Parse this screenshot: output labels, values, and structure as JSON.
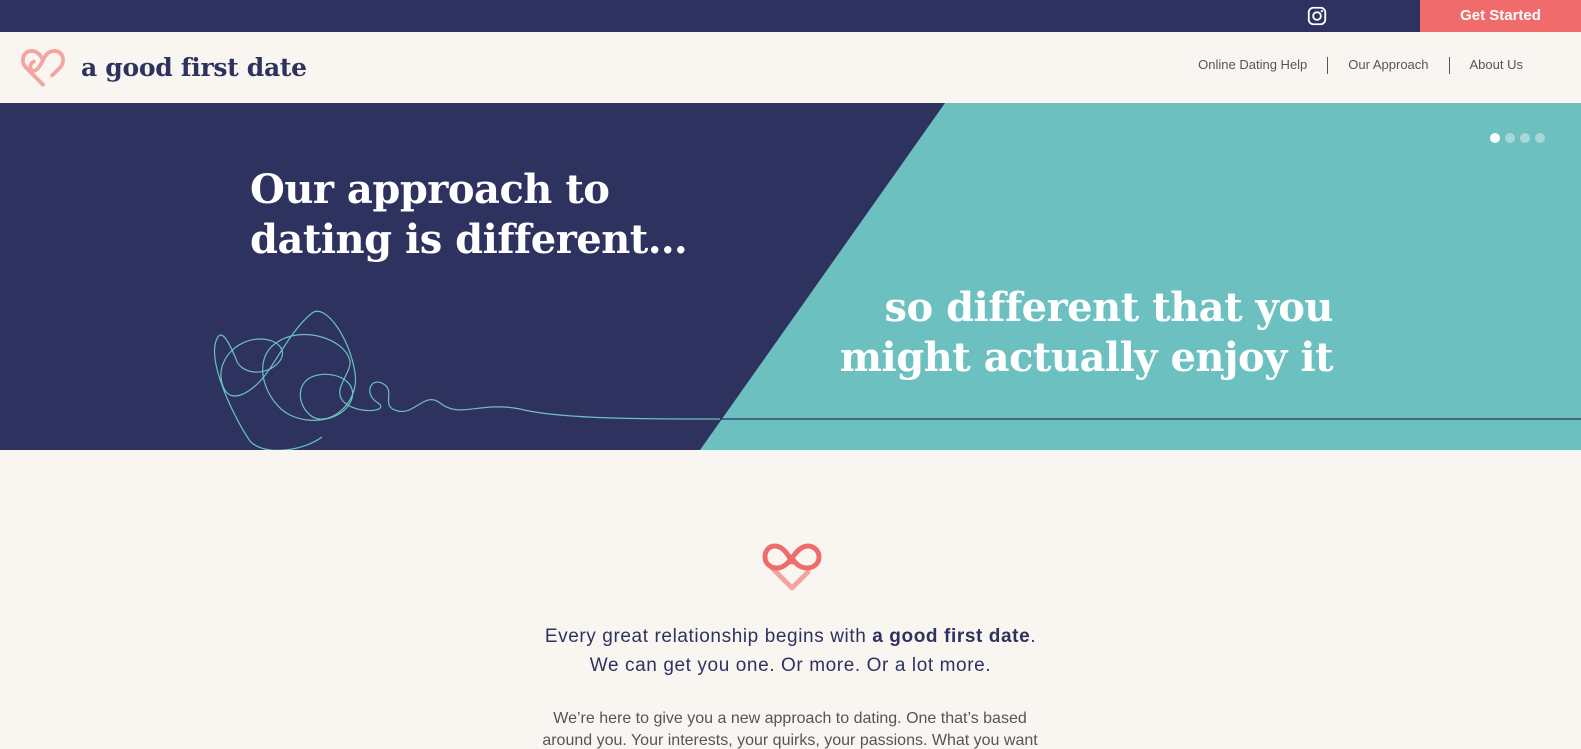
{
  "topbar": {
    "social_icon": "instagram-icon",
    "cta_label": "Get Started",
    "cta_color": "#f06b6b",
    "bg_color": "#2e325f"
  },
  "header": {
    "brand": "a good first date",
    "logo_icon": "heart-infinity-icon",
    "nav": [
      {
        "label": "Online Dating Help"
      },
      {
        "label": "Our Approach"
      },
      {
        "label": "About Us"
      }
    ]
  },
  "hero": {
    "left_line1": "Our approach to",
    "left_line2": "dating is different…",
    "right_line1": "so different that you",
    "right_line2": "might actually enjoy it",
    "navy_color": "#2e325f",
    "teal_color": "#6cc1c0",
    "slides": [
      {
        "active": true
      },
      {
        "active": false
      },
      {
        "active": false
      },
      {
        "active": false
      }
    ]
  },
  "intro": {
    "tagline_prefix": "Every great relationship begins with ",
    "tagline_brand": "a good first date",
    "tagline_suffix": ".",
    "tagline_line2": "We can get you one. Or more. Or a lot more.",
    "body_line1": "We’re here to give you a new approach to dating. One that’s based",
    "body_line2": "around you. Your interests, your quirks, your passions. What you want"
  }
}
